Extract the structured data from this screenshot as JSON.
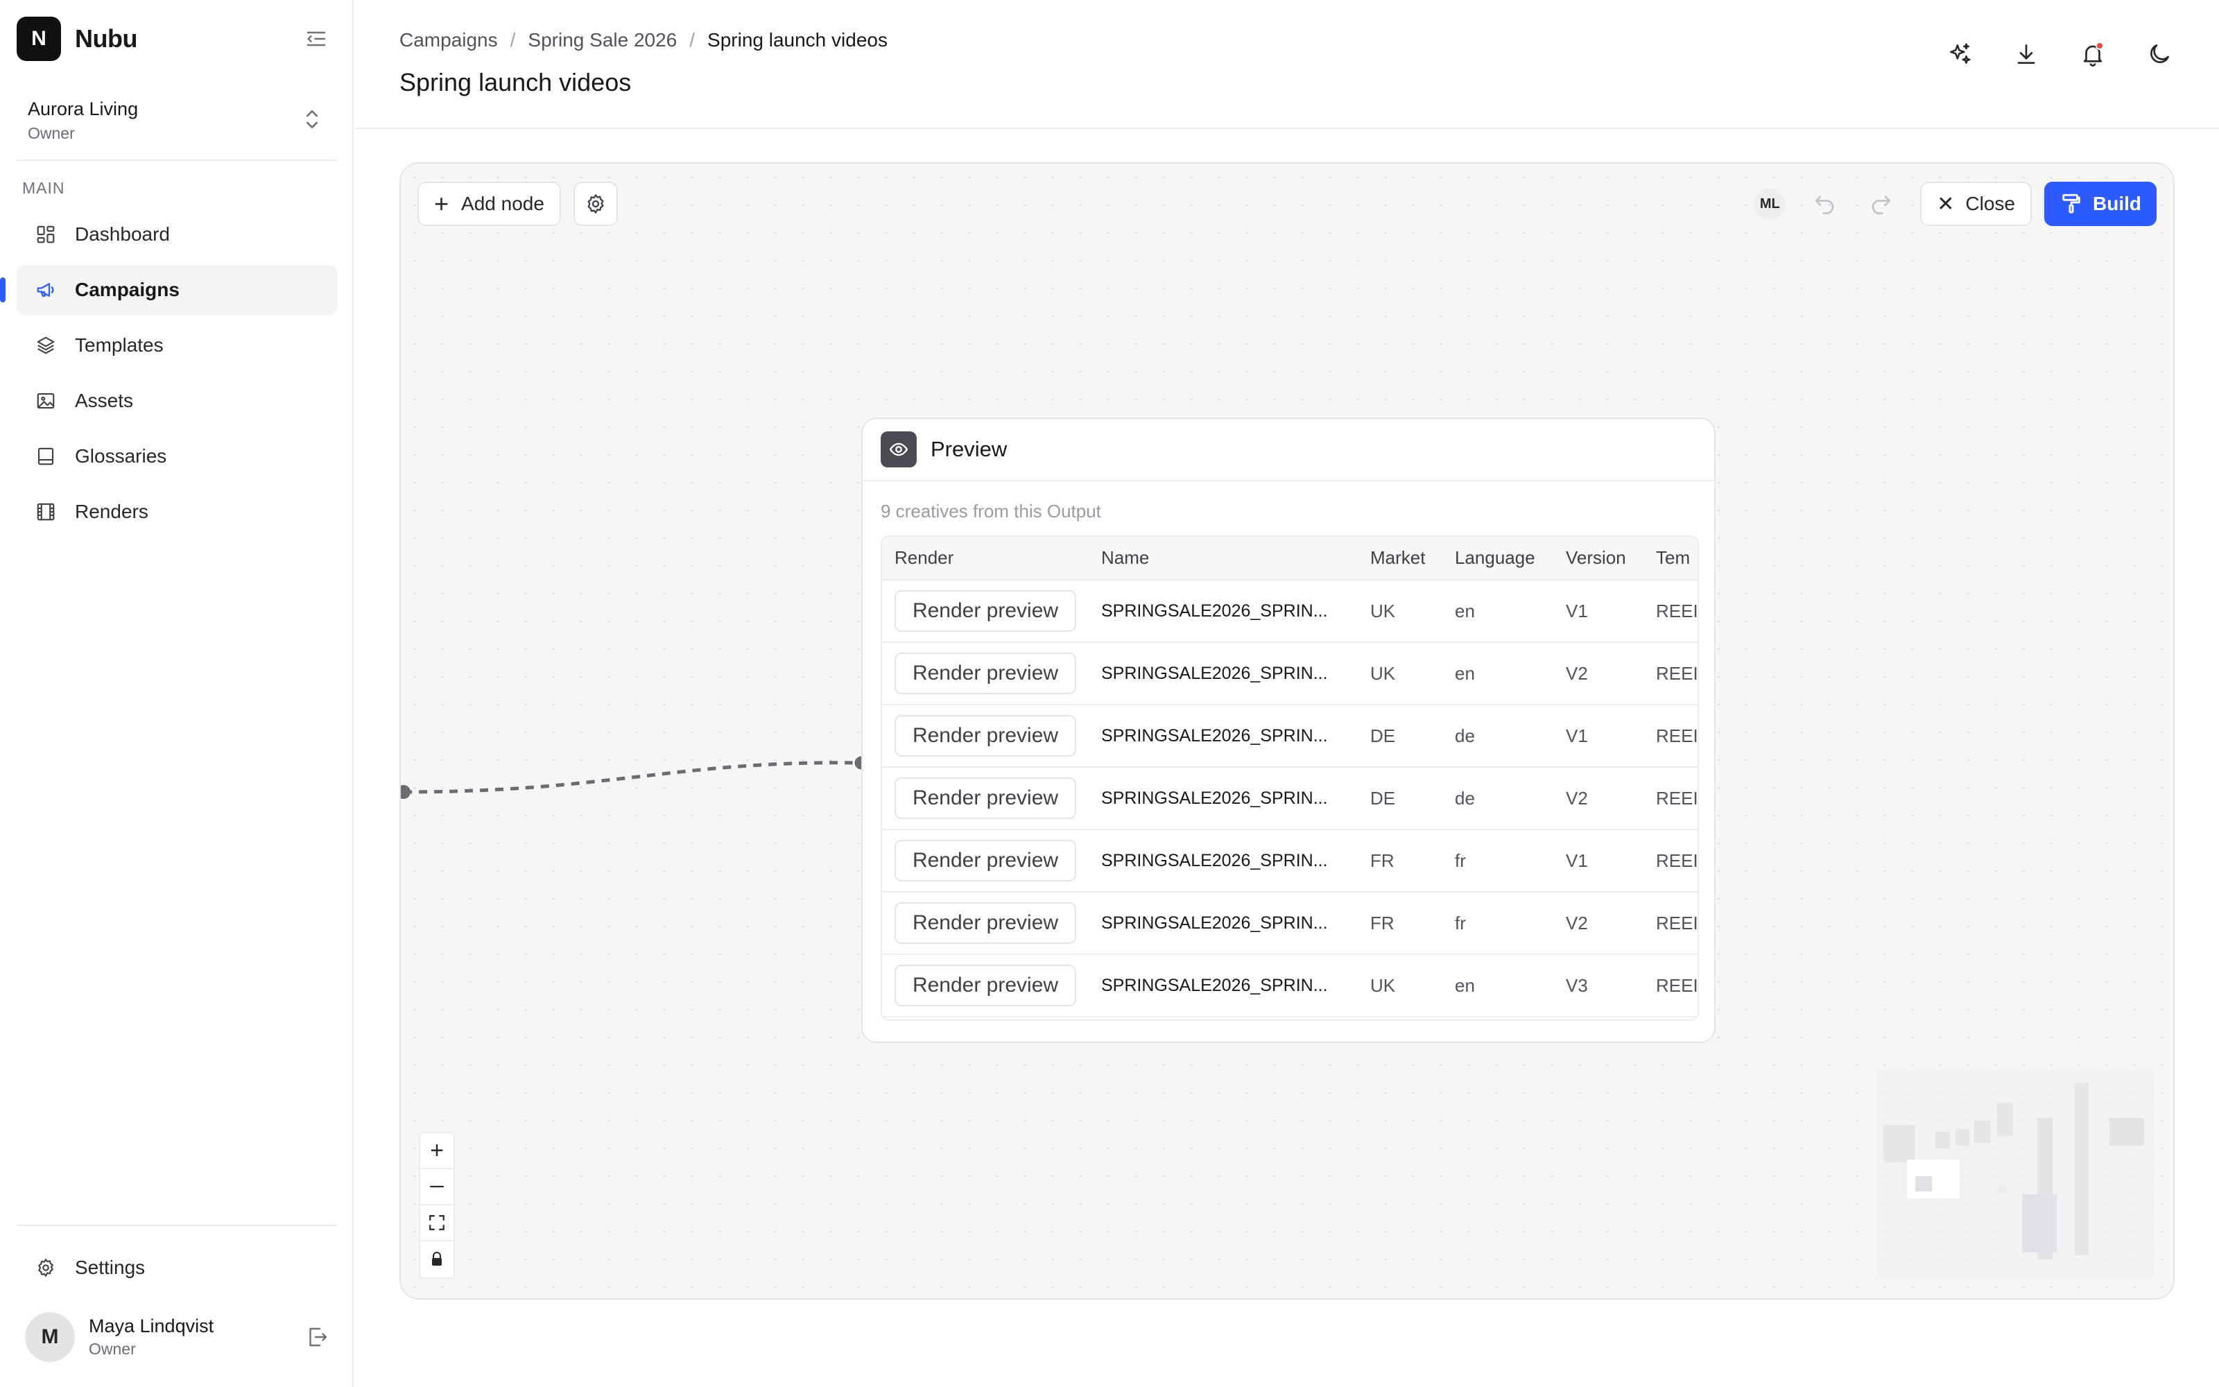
{
  "app": {
    "name": "Nubu",
    "logo_letter": "N"
  },
  "workspace": {
    "name": "Aurora Living",
    "role": "Owner"
  },
  "sidebar": {
    "section_label": "MAIN",
    "items": [
      {
        "label": "Dashboard",
        "icon": "dashboard-icon",
        "active": false
      },
      {
        "label": "Campaigns",
        "icon": "megaphone-icon",
        "active": true
      },
      {
        "label": "Templates",
        "icon": "layers-icon",
        "active": false
      },
      {
        "label": "Assets",
        "icon": "image-icon",
        "active": false
      },
      {
        "label": "Glossaries",
        "icon": "book-icon",
        "active": false
      },
      {
        "label": "Renders",
        "icon": "film-icon",
        "active": false
      }
    ],
    "settings_label": "Settings"
  },
  "user": {
    "initial": "M",
    "name": "Maya Lindqvist",
    "role": "Owner"
  },
  "header": {
    "breadcrumb": [
      "Campaigns",
      "Spring Sale 2026",
      "Spring launch videos"
    ],
    "title": "Spring launch videos"
  },
  "canvas": {
    "add_node_label": "Add node",
    "collaborator_initials": "ML",
    "close_label": "Close",
    "build_label": "Build"
  },
  "preview_node": {
    "title": "Preview",
    "subtitle": "9 creatives from this Output",
    "columns": [
      "Render",
      "Name",
      "Market",
      "Language",
      "Version",
      "Tem"
    ],
    "render_button_label": "Render preview",
    "rows": [
      {
        "name": "SPRINGSALE2026_SPRIN...",
        "market": "UK",
        "language": "en",
        "version": "V1",
        "template": "REEI"
      },
      {
        "name": "SPRINGSALE2026_SPRIN...",
        "market": "UK",
        "language": "en",
        "version": "V2",
        "template": "REEI"
      },
      {
        "name": "SPRINGSALE2026_SPRIN...",
        "market": "DE",
        "language": "de",
        "version": "V1",
        "template": "REEI"
      },
      {
        "name": "SPRINGSALE2026_SPRIN...",
        "market": "DE",
        "language": "de",
        "version": "V2",
        "template": "REEI"
      },
      {
        "name": "SPRINGSALE2026_SPRIN...",
        "market": "FR",
        "language": "fr",
        "version": "V1",
        "template": "REEI"
      },
      {
        "name": "SPRINGSALE2026_SPRIN...",
        "market": "FR",
        "language": "fr",
        "version": "V2",
        "template": "REEI"
      },
      {
        "name": "SPRINGSALE2026_SPRIN...",
        "market": "UK",
        "language": "en",
        "version": "V3",
        "template": "REEI"
      }
    ]
  },
  "colors": {
    "accent": "#2d5bff",
    "notification": "#ef4444"
  }
}
